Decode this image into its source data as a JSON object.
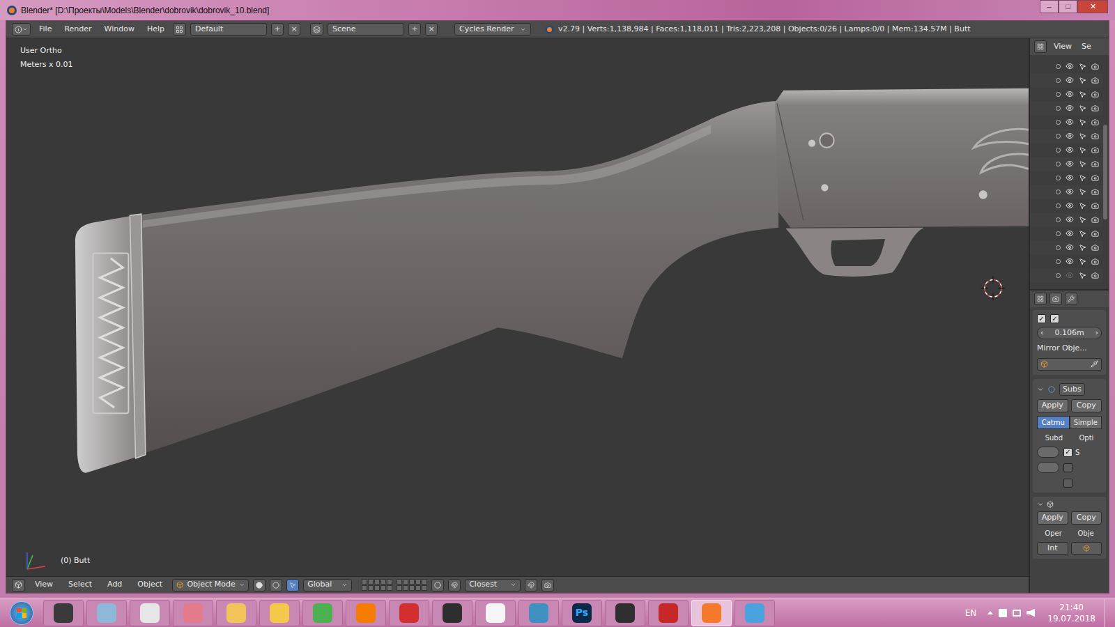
{
  "window": {
    "title": "Blender* [D:\\Проекты\\Models\\Blender\\dobrovik\\dobrovik_10.blend]",
    "controls": [
      "–",
      "□",
      "✕"
    ]
  },
  "info_header": {
    "menus": [
      "File",
      "Render",
      "Window",
      "Help"
    ],
    "layout": "Default",
    "scene": "Scene",
    "add": "+",
    "remove": "×",
    "engine": "Cycles Render",
    "stats": "v2.79 | Verts:1,138,984 | Faces:1,118,011 | Tris:2,223,208 | Objects:0/26 | Lamps:0/0 | Mem:134.57M | Butt"
  },
  "viewport": {
    "view_name": "User Ortho",
    "units": "Meters x 0.01",
    "object_label": "(0) Butt"
  },
  "view_header": {
    "menus": [
      "View",
      "Select",
      "Add",
      "Object"
    ],
    "mode": "Object Mode",
    "orientation": "Global",
    "snap": "Closest"
  },
  "outliner": {
    "header_menus": [
      "View",
      "Se"
    ],
    "rows": [
      {
        "visible": true
      },
      {
        "visible": true
      },
      {
        "visible": true
      },
      {
        "visible": true
      },
      {
        "visible": true
      },
      {
        "visible": true
      },
      {
        "visible": true
      },
      {
        "visible": true
      },
      {
        "visible": true
      },
      {
        "visible": true
      },
      {
        "visible": true
      },
      {
        "visible": true
      },
      {
        "visible": true
      },
      {
        "visible": true
      },
      {
        "visible": true
      },
      {
        "visible": false
      }
    ]
  },
  "properties": {
    "toggles": [
      {
        "checked": true
      },
      {
        "checked": true
      }
    ],
    "distance": {
      "value": "0.106m",
      "dec": "‹",
      "inc": "›"
    },
    "mirror_label": "Mirror Obje...",
    "modifier": {
      "name": "Subs",
      "apply": "Apply",
      "copy": "Copy",
      "types": [
        {
          "label": "Catmu",
          "selected": true
        },
        {
          "label": "Simple",
          "selected": false
        }
      ],
      "col_headers": [
        "Subd",
        "Opti"
      ],
      "options": [
        {
          "label": "S",
          "checked": true
        },
        {
          "label": "",
          "checked": false
        },
        {
          "label": "",
          "checked": false
        }
      ]
    },
    "modifier2": {
      "apply": "Apply",
      "copy": "Copy",
      "col_headers": [
        "Oper",
        "Obje"
      ],
      "operation": "Int"
    }
  },
  "taskbar": {
    "apps": [
      {
        "label": "",
        "selected": false
      },
      {
        "label": "",
        "selected": false
      },
      {
        "label": "",
        "selected": false
      },
      {
        "label": "",
        "selected": false
      },
      {
        "label": "",
        "selected": false
      },
      {
        "label": "",
        "selected": false
      },
      {
        "label": "",
        "selected": false
      },
      {
        "label": "",
        "selected": false
      },
      {
        "label": "",
        "selected": false
      },
      {
        "label": "",
        "selected": false
      },
      {
        "label": "",
        "selected": false
      },
      {
        "label": "",
        "selected": false
      },
      {
        "label": "Ps",
        "selected": false
      },
      {
        "label": "",
        "selected": false
      },
      {
        "label": "",
        "selected": false
      },
      {
        "label": "",
        "selected": true
      },
      {
        "label": "",
        "selected": false
      }
    ],
    "language": "EN",
    "time": "21:40",
    "date": "19.07.2018"
  }
}
